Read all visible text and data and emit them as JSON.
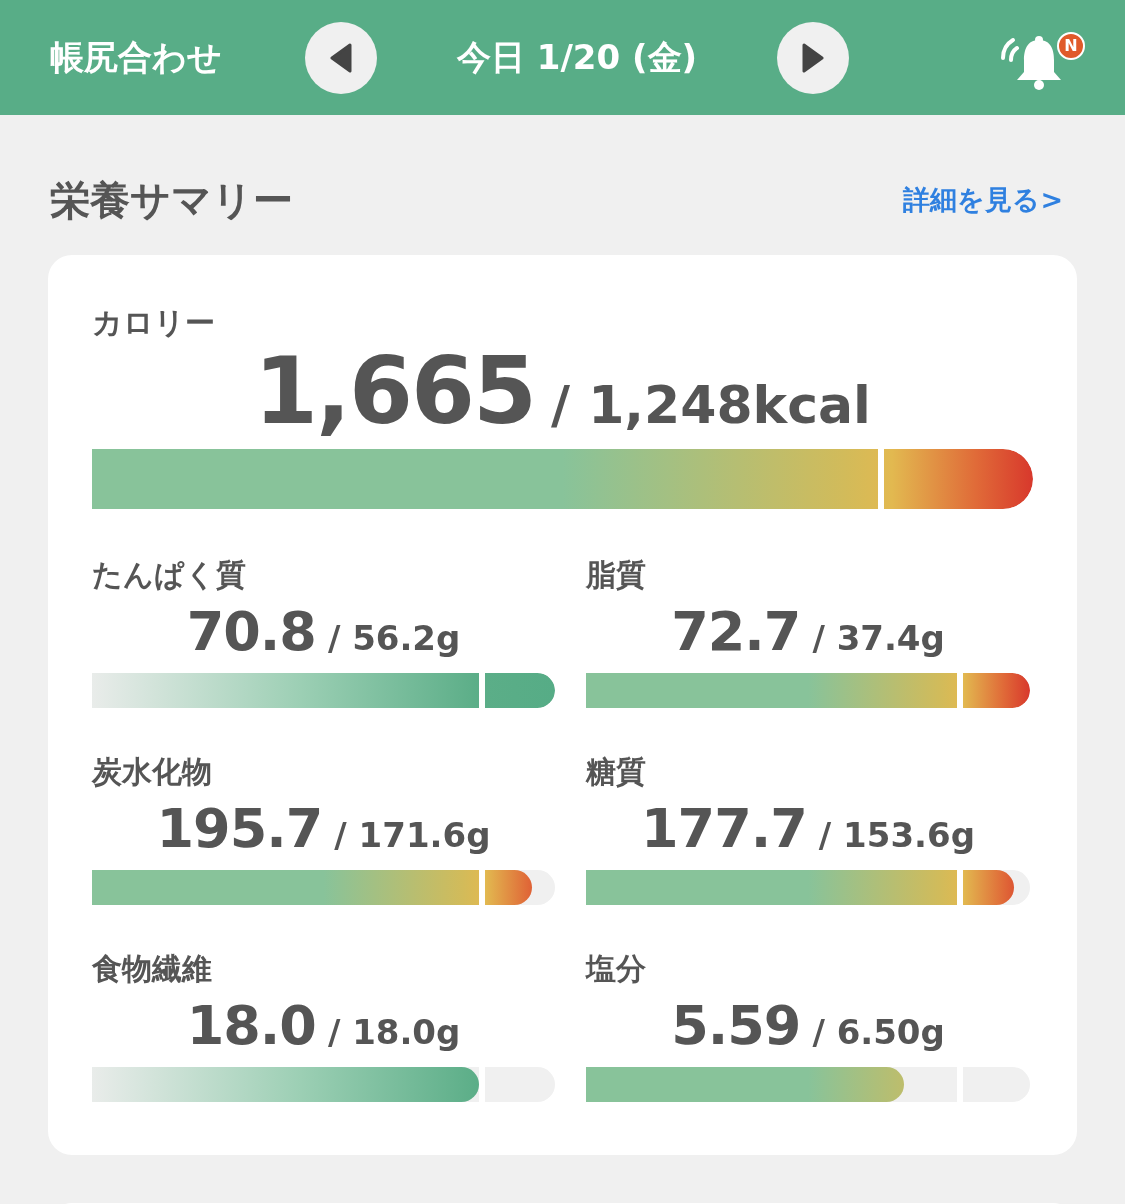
{
  "header": {
    "title": "帳尻合わせ",
    "date": "今日 1/20 (金)",
    "badge": "N"
  },
  "summary": {
    "title": "栄養サマリー",
    "link": "詳細を見る>"
  },
  "calorie": {
    "label": "カロリー",
    "value": "1,665",
    "target": "/ 1,248kcal",
    "kind": "warm",
    "level": 1
  },
  "nutrients": [
    {
      "label": "たんぱく質",
      "value": "70.8",
      "target": "/ 56.2g",
      "kind": "pale",
      "level": 1
    },
    {
      "label": "脂質",
      "value": "72.7",
      "target": "/ 37.4g",
      "kind": "warm",
      "level": 1
    },
    {
      "label": "炭水化物",
      "value": "195.7",
      "target": "/ 171.6g",
      "kind": "warm",
      "level": 0.95
    },
    {
      "label": "糖質",
      "value": "177.7",
      "target": "/ 153.6g",
      "kind": "warm",
      "level": 0.964
    },
    {
      "label": "食物繊維",
      "value": "18.0",
      "target": "/ 18.0g",
      "kind": "pale",
      "level": 0.836
    },
    {
      "label": "塩分",
      "value": "5.59",
      "target": "/ 6.50g",
      "kind": "warm",
      "level": 0.716
    }
  ]
}
